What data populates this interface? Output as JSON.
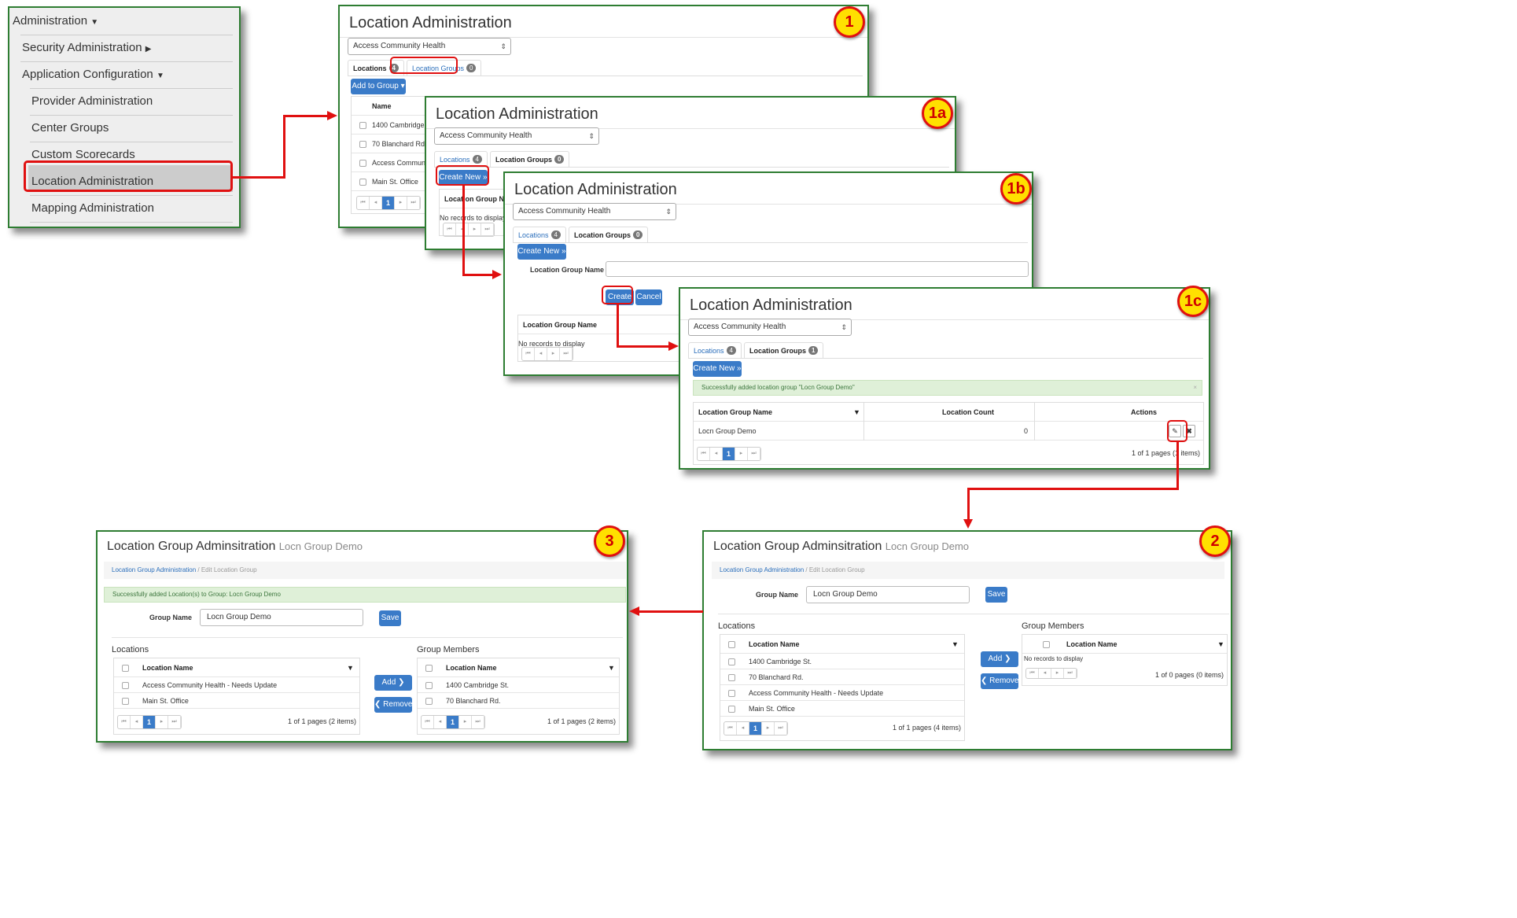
{
  "menu": {
    "administration": "Administration",
    "security_administration": "Security Administration",
    "application_configuration": "Application Configuration",
    "provider_administration": "Provider Administration",
    "center_groups": "Center Groups",
    "custom_scorecards": "Custom Scorecards",
    "location_administration": "Location Administration",
    "mapping_administration": "Mapping Administration"
  },
  "step_labels": {
    "s1": "1",
    "s1a": "1a",
    "s1b": "1b",
    "s1c": "1c",
    "s2": "2",
    "s3": "3"
  },
  "common": {
    "title": "Location Administration",
    "org_select": "Access Community Health",
    "tab_locations": "Locations",
    "tab_location_groups": "Location Groups",
    "create_new": "Create New »",
    "no_records": "No records to display",
    "location_group_name": "Location Group Name",
    "page_current": "1"
  },
  "panel1": {
    "locations_count": "4",
    "groups_count": "0",
    "add_to_group": "Add to Group ▾",
    "col_name": "Name",
    "rows": [
      "1400 Cambridge St.",
      "70 Blanchard Rd.",
      "Access Community H",
      "Main St. Office"
    ]
  },
  "panel1a": {
    "locations_count": "4",
    "groups_count": "0",
    "col_header": "Location Group Name"
  },
  "panel1b": {
    "locations_count": "4",
    "groups_count": "0",
    "form_label": "Location Group Name",
    "create": "Create",
    "cancel": "Cancel",
    "col_header": "Location Group Name"
  },
  "panel1c": {
    "locations_count": "4",
    "groups_count": "1",
    "alert": "Successfully added location group \"Locn Group Demo\"",
    "col_group_name": "Location Group Name",
    "col_location_count": "Location Count",
    "col_actions": "Actions",
    "row_name": "Locn Group Demo",
    "row_count": "0",
    "pager_info": "1 of 1 pages (1 items)"
  },
  "panel2": {
    "title": "Location Group Adminsitration",
    "subtitle": "Locn Group Demo",
    "crumb_link": "Location Group Administration",
    "crumb_current": "Edit Location Group",
    "group_name_label": "Group Name",
    "group_name_value": "Locn Group Demo",
    "save": "Save",
    "locations_heading": "Locations",
    "members_heading": "Group Members",
    "col_location_name": "Location Name",
    "locations": [
      "1400 Cambridge St.",
      "70 Blanchard Rd.",
      "Access Community Health - Needs Update",
      "Main St. Office"
    ],
    "locations_pager": "1 of 1 pages (4 items)",
    "add": "Add ❯",
    "remove": "❮ Remove",
    "members_empty": "No records to display",
    "members_pager": "1 of 0 pages (0 items)"
  },
  "panel3": {
    "title": "Location Group Adminsitration",
    "subtitle": "Locn Group Demo",
    "crumb_link": "Location Group Administration",
    "crumb_current": "Edit Location Group",
    "alert": "Successfully added Location(s) to Group: Locn Group Demo",
    "group_name_label": "Group Name",
    "group_name_value": "Locn Group Demo",
    "save": "Save",
    "locations_heading": "Locations",
    "members_heading": "Group Members",
    "col_location_name": "Location Name",
    "locations": [
      "Access Community Health - Needs Update",
      "Main St. Office"
    ],
    "locations_pager": "1 of 1 pages (2 items)",
    "add": "Add ❯",
    "remove": "❮ Remove",
    "members": [
      "1400 Cambridge St.",
      "70 Blanchard Rd."
    ],
    "members_pager": "1 of 1 pages (2 items)"
  },
  "colors": {
    "accent": "#3a7bc8",
    "highlight": "#e01010",
    "panel_border": "#2e7d32",
    "step_badge": "#ffe000"
  }
}
